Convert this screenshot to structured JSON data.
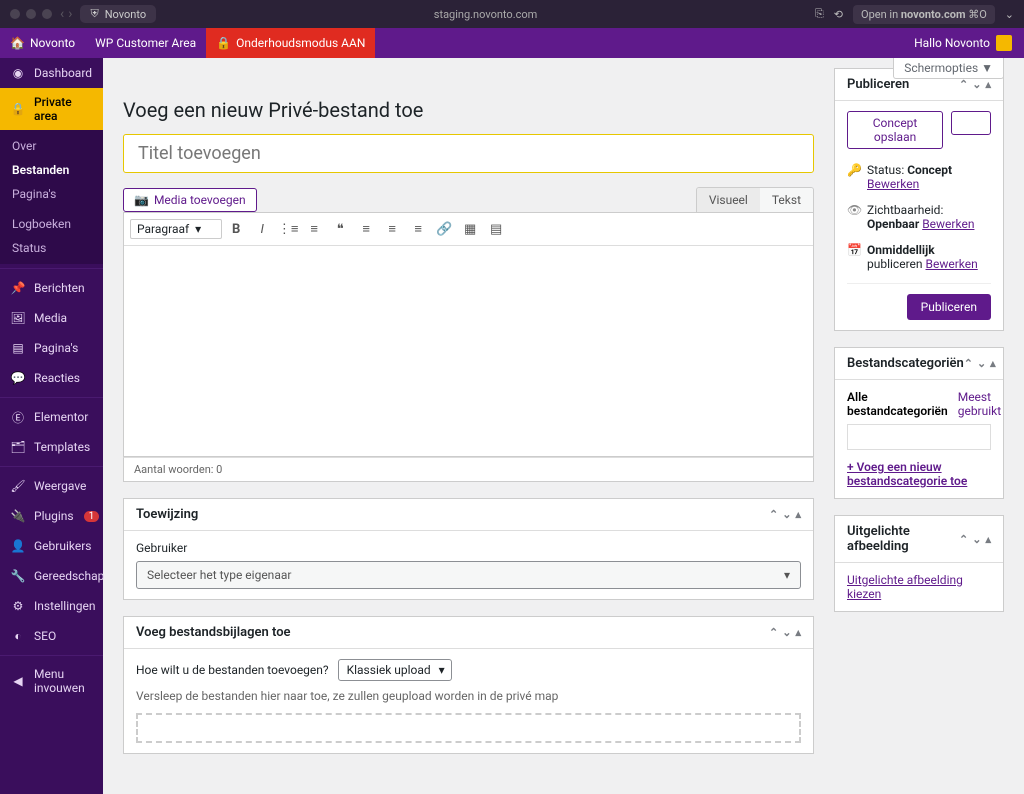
{
  "browser": {
    "tab_name": "Novonto",
    "url": "staging.novonto.com",
    "open_in_prefix": "Open in ",
    "open_in_domain": "novonto.com",
    "open_in_suffix": " ⌘O"
  },
  "adminbar": {
    "site": "Novonto",
    "wpca": "WP Customer Area",
    "maintenance": "Onderhoudsmodus AAN",
    "greeting": "Hallo Novonto"
  },
  "sidebar": {
    "dashboard": "Dashboard",
    "private_area": "Private area",
    "submenu": {
      "over": "Over",
      "bestanden": "Bestanden",
      "paginas": "Pagina's",
      "logboeken": "Logboeken",
      "status": "Status"
    },
    "berichten": "Berichten",
    "media": "Media",
    "paginas": "Pagina's",
    "reacties": "Reacties",
    "elementor": "Elementor",
    "templates": "Templates",
    "weergave": "Weergave",
    "plugins": "Plugins",
    "plugins_count": "1",
    "gebruikers": "Gebruikers",
    "gereedschap": "Gereedschap",
    "instellingen": "Instellingen",
    "seo": "SEO",
    "collapse": "Menu invouwen"
  },
  "screen_options": "Schermopties ▼",
  "page_title": "Voeg een nieuw Privé-bestand toe",
  "title_placeholder": "Titel toevoegen",
  "media_button": "Media toevoegen",
  "editor_tabs": {
    "visual": "Visueel",
    "text": "Tekst"
  },
  "format_dropdown": "Paragraaf",
  "word_count": "Aantal woorden: 0",
  "toewijzing": {
    "title": "Toewijzing",
    "label": "Gebruiker",
    "placeholder": "Selecteer het type eigenaar"
  },
  "attachments": {
    "title": "Voeg bestandsbijlagen toe",
    "question": "Hoe wilt u de bestanden toevoegen?",
    "method": "Klassiek upload",
    "help": "Versleep de bestanden hier naar toe, ze zullen geupload worden in de privé map"
  },
  "publish": {
    "title": "Publiceren",
    "save_draft": "Concept opslaan",
    "status_label": "Status:",
    "status_value": "Concept",
    "visibility_label": "Zichtbaarheid:",
    "visibility_value": "Openbaar",
    "schedule_prefix": "Onmiddellijk",
    "schedule_suffix": "publiceren",
    "edit": "Bewerken",
    "button": "Publiceren"
  },
  "categories": {
    "title": "Bestandscategoriën",
    "tab_all": "Alle bestandcategoriën",
    "tab_most": "Meest gebruikt",
    "add_new": "+ Voeg een nieuw bestandscategorie toe"
  },
  "featured": {
    "title": "Uitgelichte afbeelding",
    "link": "Uitgelichte afbeelding kiezen"
  }
}
